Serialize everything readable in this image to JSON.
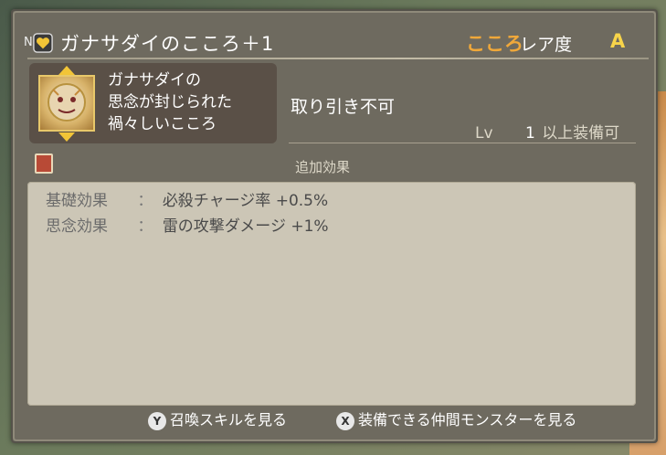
{
  "header": {
    "rank": "N",
    "title": "ガナサダイのこころ＋1",
    "rarity_word": "こころ",
    "rarity_label": "レア度",
    "rarity_grade": "A"
  },
  "card": {
    "lines": [
      "ガナサダイの",
      "思念が封じられた",
      "禍々しいこころ"
    ]
  },
  "trade_status": "取り引き不可",
  "level": {
    "label": "Lv",
    "value": "1",
    "suffix": "以上装備可"
  },
  "section_label": "追加効果",
  "effects": [
    {
      "key": "基礎効果",
      "sep": "：",
      "value": "必殺チャージ率 +0.5%"
    },
    {
      "key": "思念効果",
      "sep": "：",
      "value": "雷の攻撃ダメージ +1%"
    }
  ],
  "footer": {
    "y_button": "Y",
    "y_label": "召喚スキルを見る",
    "x_button": "X",
    "x_label": "装備できる仲間モンスターを見る"
  },
  "colors": {
    "panel": "#6e6a5f",
    "effects_bg": "#ccc6b6",
    "rarity_word": "#f0a83a",
    "rarity_grade": "#f7d44a",
    "card_bg": "#5a5047"
  }
}
